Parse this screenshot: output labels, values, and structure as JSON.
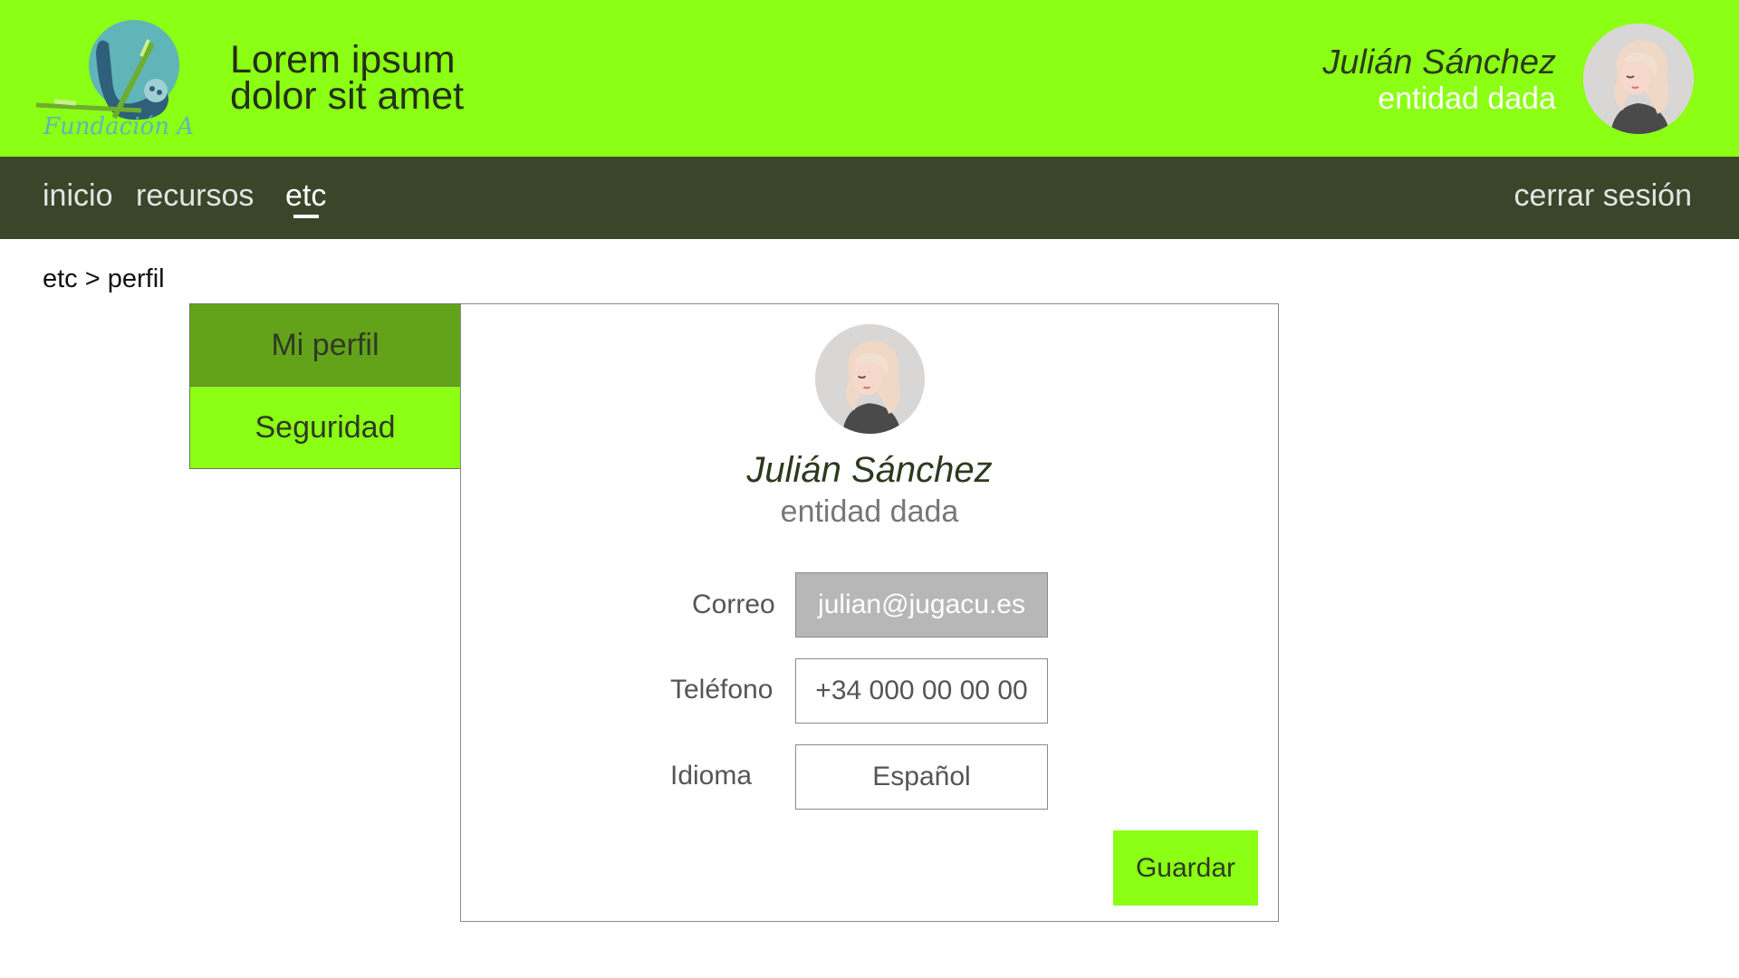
{
  "header": {
    "logo_text": "Fundación A",
    "brand_line1": "Lorem ipsum",
    "brand_line2": "dolor sit amet",
    "user_name": "Julián Sánchez",
    "user_entity": "entidad dada"
  },
  "nav": {
    "items": [
      {
        "label": "inicio",
        "active": false
      },
      {
        "label": "recursos",
        "active": false
      },
      {
        "label": "etc",
        "active": true
      }
    ],
    "logout_label": "cerrar sesión"
  },
  "breadcrumb": "etc > perfil",
  "side_tabs": [
    {
      "label": "Mi perfil",
      "active": true
    },
    {
      "label": "Seguridad",
      "active": false
    }
  ],
  "profile": {
    "name": "Julián Sánchez",
    "entity": "entidad dada",
    "fields": {
      "email_label": "Correo",
      "email_value": "julian@jugacu.es",
      "phone_label": "Teléfono",
      "phone_value": "+34 000 00 00 00",
      "language_label": "Idioma",
      "language_value": "Español"
    },
    "save_label": "Guardar"
  },
  "colors": {
    "accent": "#8bff14",
    "accent_dark": "#63a31a",
    "nav_bg": "#3a4629"
  }
}
